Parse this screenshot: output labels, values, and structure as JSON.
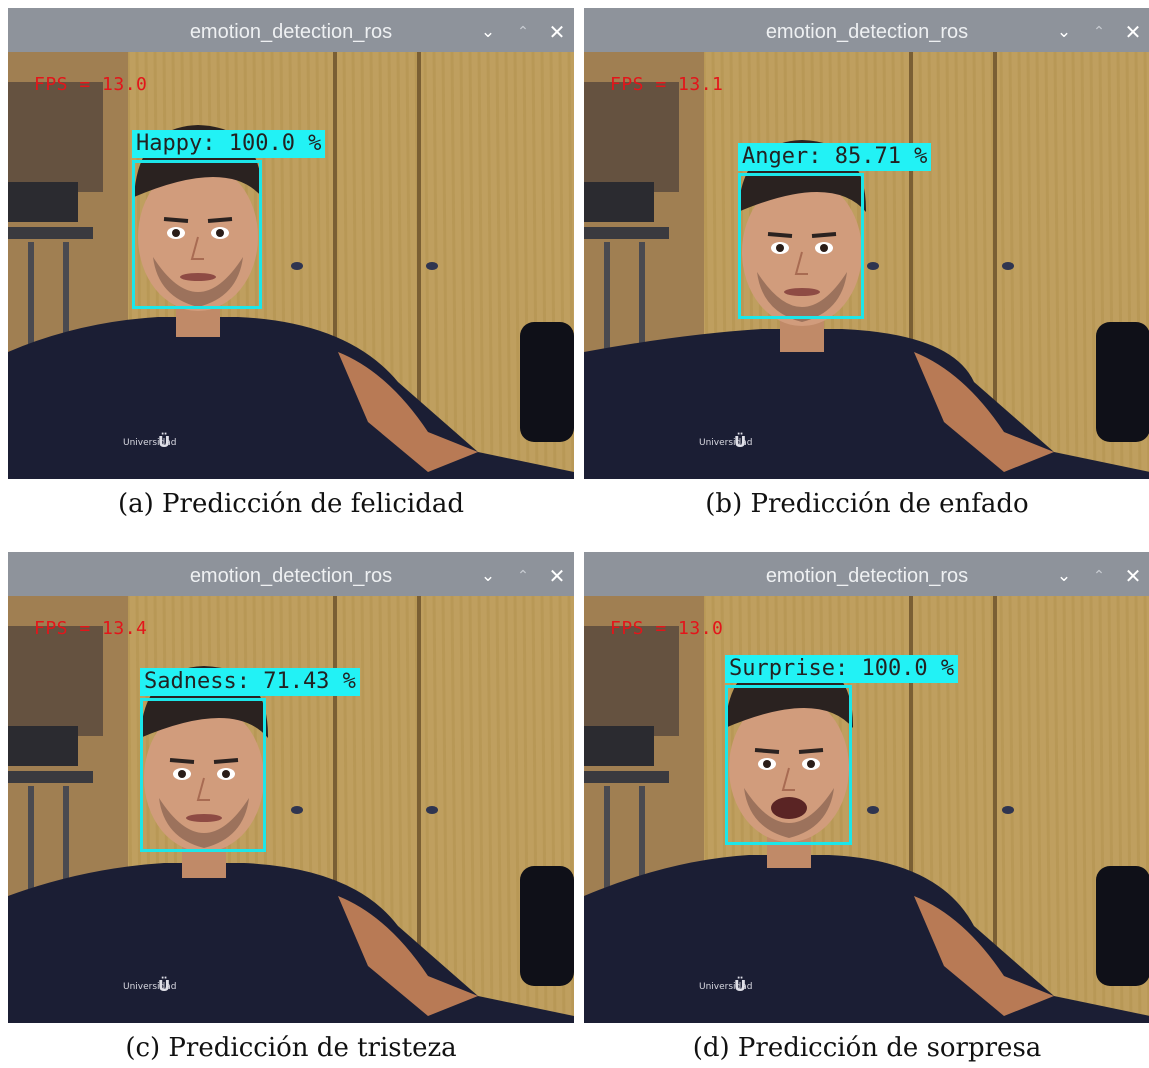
{
  "window": {
    "title": "emotion_detection_ros",
    "controls": {
      "minimize_icon": "chevron-down-icon",
      "maximize_icon": "chevron-up-icon",
      "close_icon": "close-icon"
    }
  },
  "colors": {
    "titlebar": "#8e939b",
    "box": "#1ce6e9",
    "label_bg": "#22f2f5",
    "fps_text": "#e3151a"
  },
  "panels": [
    {
      "fps": "FPS = 13.0",
      "label": "Happy: 100.0 %",
      "caption": "(a) Predicción de felicidad"
    },
    {
      "fps": "FPS = 13.1",
      "label": "Anger: 85.71 %",
      "caption": "(b) Predicción de enfado"
    },
    {
      "fps": "FPS = 13.4",
      "label": "Sadness: 71.43 %",
      "caption": "(c) Predicción de tristeza"
    },
    {
      "fps": "FPS = 13.0",
      "label": "Surprise: 100.0 %",
      "caption": "(d) Predicción de sorpresa"
    }
  ]
}
